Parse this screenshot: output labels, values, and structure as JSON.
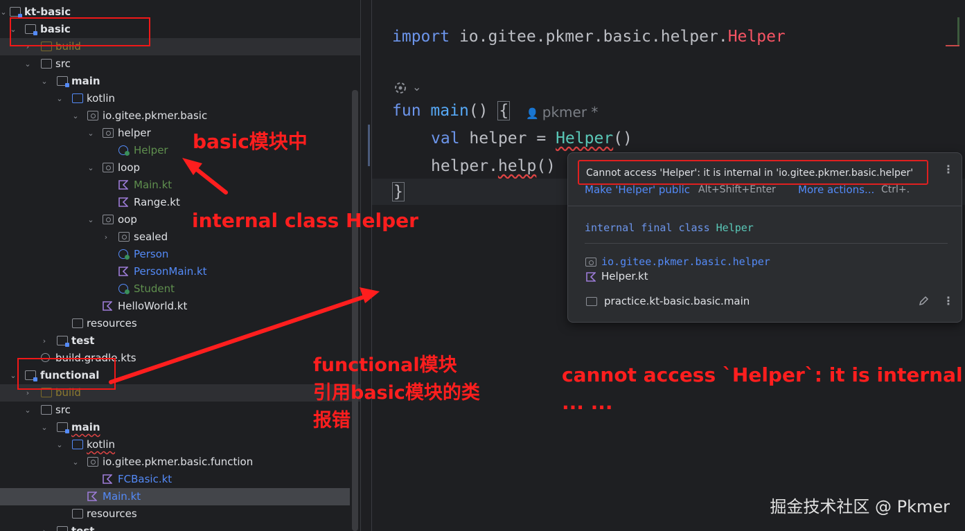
{
  "tree": {
    "rows": [
      {
        "label": "kt-basic",
        "bold": true
      },
      {
        "label": "basic",
        "bold": true
      },
      {
        "label": "build"
      },
      {
        "label": "src"
      },
      {
        "label": "main",
        "bold": true
      },
      {
        "label": "kotlin"
      },
      {
        "label": "io.gitee.pkmer.basic"
      },
      {
        "label": "helper"
      },
      {
        "label": "Helper"
      },
      {
        "label": "loop"
      },
      {
        "label": "Main.kt"
      },
      {
        "label": "Range.kt"
      },
      {
        "label": "oop"
      },
      {
        "label": "sealed"
      },
      {
        "label": "Person"
      },
      {
        "label": "PersonMain.kt"
      },
      {
        "label": "Student"
      },
      {
        "label": "HelloWorld.kt"
      },
      {
        "label": "resources"
      },
      {
        "label": "test",
        "bold": true
      },
      {
        "label": "build.gradle.kts"
      },
      {
        "label": "functional",
        "bold": true
      },
      {
        "label": "build"
      },
      {
        "label": "src"
      },
      {
        "label": "main",
        "bold": true
      },
      {
        "label": "kotlin"
      },
      {
        "label": "io.gitee.pkmer.basic.function"
      },
      {
        "label": "FCBasic.kt"
      },
      {
        "label": "Main.kt"
      },
      {
        "label": "resources"
      },
      {
        "label": "test",
        "bold": true
      }
    ]
  },
  "editor": {
    "import_kw": "import",
    "import_path": "io.gitee.pkmer.basic.helper.",
    "import_cls": "Helper",
    "fun_kw": "fun",
    "fun_name": "main",
    "fun_parens": "()",
    "open_brace": "{",
    "author_hint": "pkmer *",
    "val_kw": "val",
    "val_name": "helper",
    "eq": "=",
    "ctor_name": "Helper",
    "ctor_parens": "()",
    "call_recv": "helper.",
    "call_name": "help",
    "call_parens": "()",
    "close_brace": "}"
  },
  "popup": {
    "error": "Cannot access 'Helper': it is internal in 'io.gitee.pkmer.basic.helper'",
    "fix_link": "Make 'Helper' public",
    "fix_shortcut": "Alt+Shift+Enter",
    "more_link": "More actions...",
    "more_shortcut": "Ctrl+.",
    "decl_mods": "internal final class",
    "decl_name": "Helper",
    "pkg": "io.gitee.pkmer.basic.helper",
    "file": "Helper.kt",
    "module": "practice.kt-basic.basic.main"
  },
  "annotations": {
    "basic_module": "basic模块中",
    "internal_class": "internal class Helper",
    "functional_line1": "functional模块",
    "functional_line2": "引用basic模块的类",
    "functional_line3": "报错",
    "cannot_access_line1": "cannot access `Helper`: it is internal in",
    "cannot_access_line2": "... ..."
  },
  "watermark": "掘金技术社区 @ Pkmer",
  "colors": {
    "annotation_red": "#ff1e1e",
    "keyword": "#6c95eb",
    "function": "#56a8f5",
    "error": "#f75464"
  }
}
